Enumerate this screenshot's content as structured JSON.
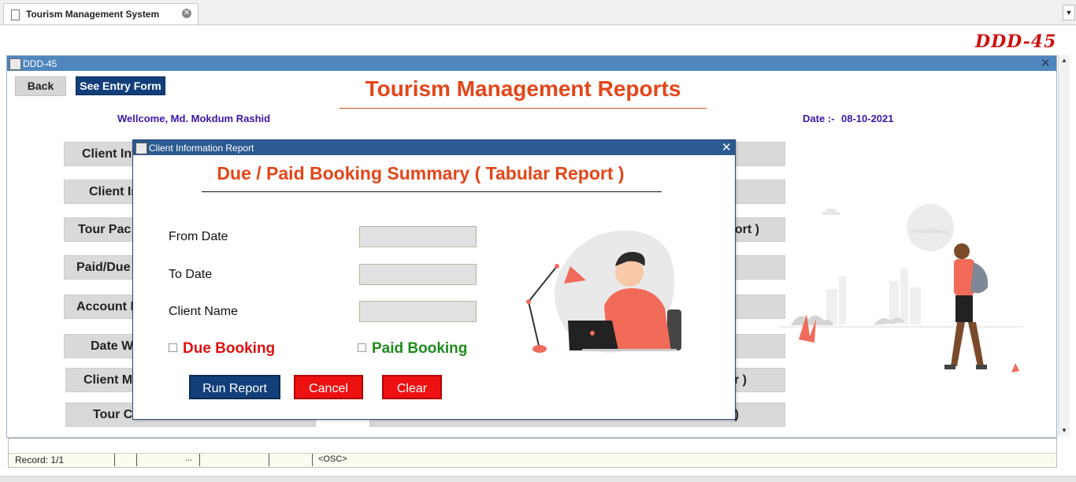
{
  "browser": {
    "tab_title": "Tourism Management System"
  },
  "brand": "DDD-45",
  "window": {
    "title": "DDD-45",
    "back_label": "Back",
    "entry_form_label": "See Entry Form",
    "main_title": "Tourism Management Reports",
    "welcome": "Wellcome, Md. Mokdum Rashid",
    "date_label": "Date :-",
    "date_value": "08-10-2021",
    "left_buttons": [
      "Client Inf",
      "Client In",
      "Tour Pac",
      "Paid/Due",
      "Account I",
      "Date W",
      "Client M",
      "Tour C"
    ],
    "right_buttons": [
      "",
      "",
      "ort )",
      "",
      "",
      "",
      "r )",
      ")"
    ]
  },
  "dialog": {
    "title": "Client Information Report",
    "heading": "Due / Paid Booking Summary ( Tabular Report )",
    "from_date_label": "From Date",
    "to_date_label": "To Date",
    "client_name_label": "Client Name",
    "from_date_value": "",
    "to_date_value": "",
    "client_name_value": "",
    "due_booking_label": "Due Booking",
    "paid_booking_label": "Paid Booking",
    "run_label": "Run Report",
    "cancel_label": "Cancel",
    "clear_label": "Clear"
  },
  "statusbar": {
    "record": "Record: 1/1",
    "dots": "...",
    "osc": "<OSC>"
  },
  "colors": {
    "title_orange": "#e2461a",
    "navy_button": "#123f7a",
    "red_button": "#ee1111",
    "due_red": "#dd1111",
    "paid_green": "#1d8a1d",
    "welcome_purple": "#3a18a8",
    "window_titlebar": "#4f86bd"
  }
}
